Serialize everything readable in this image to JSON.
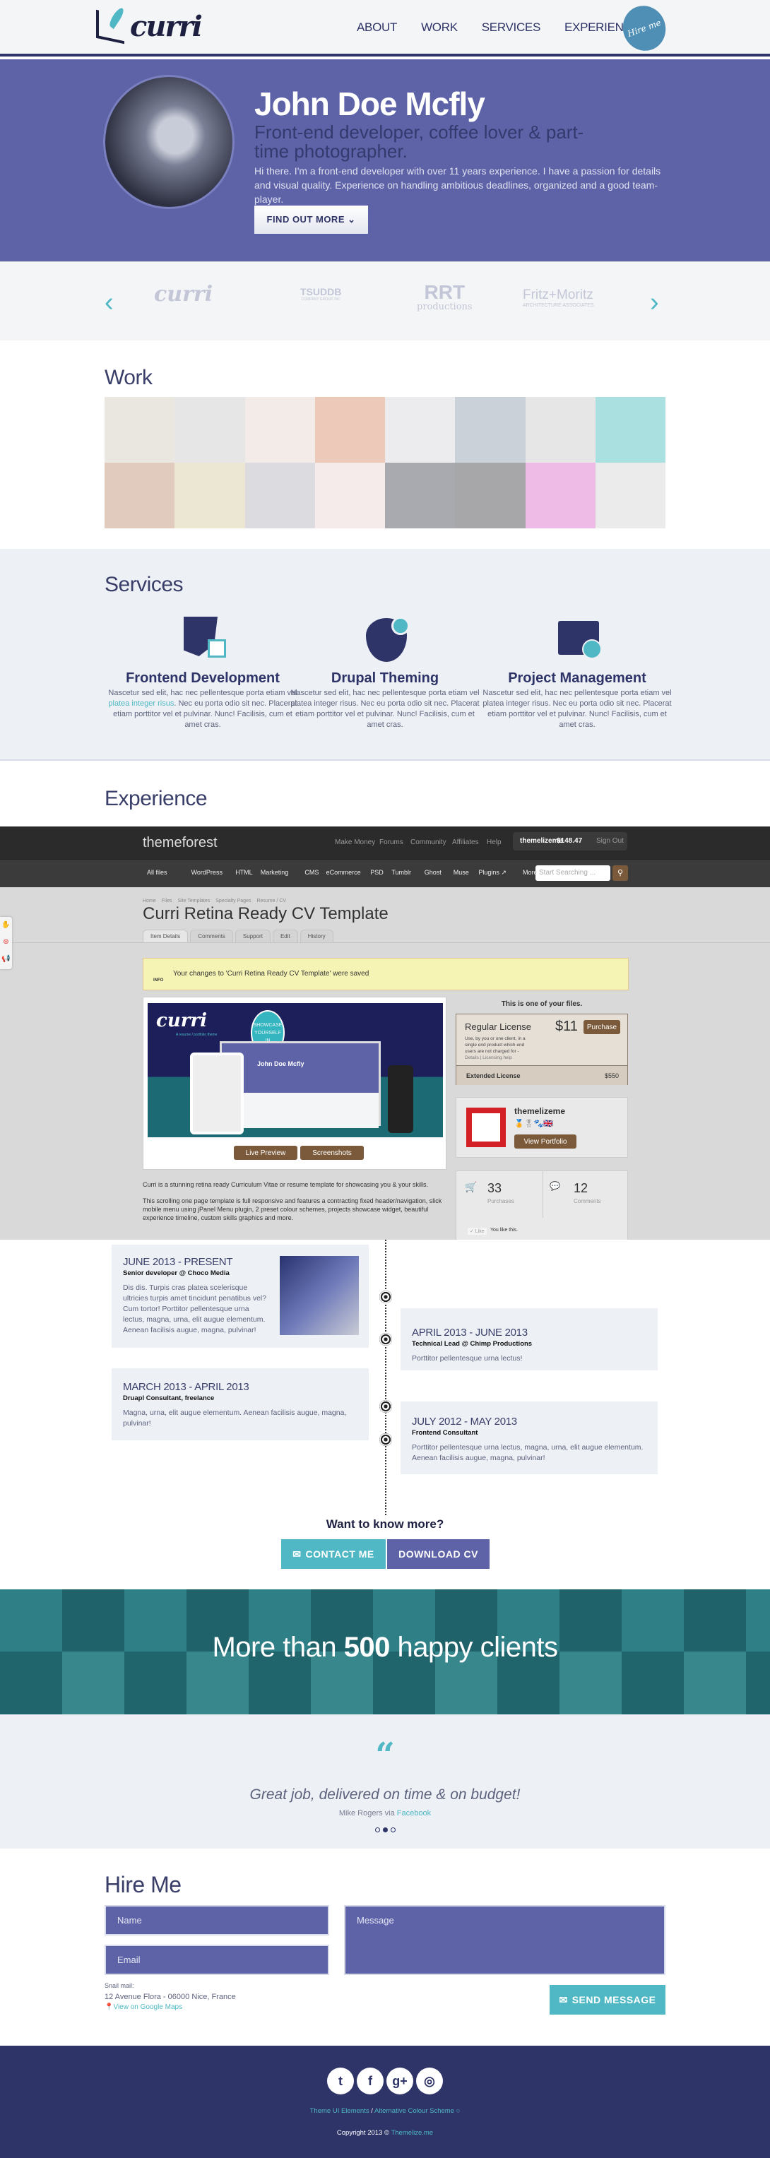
{
  "colors": {
    "primary": "#5e63a8",
    "dark": "#2e3468",
    "accent": "#4fb8c4",
    "light": "#edf0f5"
  },
  "header": {
    "logo": "curri",
    "nav": [
      "ABOUT",
      "WORK",
      "SERVICES",
      "EXPERIENCE"
    ],
    "hire_badge": "Hire me"
  },
  "hero": {
    "name": "John Doe Mcfly",
    "tagline": "Front-end developer, coffee lover & part-time photographer.",
    "intro": "Hi there. I'm a front-end developer with over 11 years experience. I have a passion for details and visual quality. Experience on handling ambitious deadlines, organized and a good team-player.",
    "button": "FIND OUT MORE ⌄"
  },
  "clients": {
    "logos": [
      {
        "name": "curri"
      },
      {
        "name": "TSUDDB",
        "sub": "COMPANY GROUP, INC"
      },
      {
        "name": "RRT",
        "sub": "productions"
      },
      {
        "name": "Fritz+Moritz",
        "sub": "ARCHITECTURE ASSOCIATES"
      }
    ]
  },
  "work": {
    "title": "Work"
  },
  "services": {
    "title": "Services",
    "items": [
      {
        "title": "Frontend Development",
        "icon": "css3-icon",
        "text_a": "Nascetur sed elit, hac nec pellentesque porta etiam vel ",
        "link": "platea integer risus",
        "text_b": ". Nec eu porta odio sit nec. Placerat etiam porttitor vel et pulvinar. Nunc! Facilisis, cum et amet cras."
      },
      {
        "title": "Drupal Theming",
        "icon": "drupal-icon",
        "text_a": "Nascetur sed elit, hac nec pellentesque porta etiam vel platea integer risus. Nec eu porta odio sit nec. Placerat etiam porttitor vel et pulvinar. Nunc! Facilisis, cum et amet cras.",
        "link": "",
        "text_b": ""
      },
      {
        "title": "Project Management",
        "icon": "folder-icon",
        "text_a": "Nascetur sed elit, hac nec pellentesque porta etiam vel platea integer risus. Nec eu porta odio sit nec. Placerat etiam porttitor vel et pulvinar. Nunc! Facilisis, cum et amet cras.",
        "link": "",
        "text_b": ""
      }
    ]
  },
  "experience": {
    "title": "Experience"
  },
  "themeforest": {
    "brand": "themeforest",
    "top_links": [
      "Make Money",
      "Forums",
      "Community",
      "Affiliates",
      "Help"
    ],
    "user": "themelizeme",
    "balance": "$148.47",
    "sign_out": "Sign Out",
    "categories": [
      "All files",
      "WordPress",
      "HTML",
      "Marketing",
      "CMS",
      "eCommerce",
      "PSD",
      "Tumblr",
      "Ghost",
      "Muse",
      "Plugins ↗",
      "More"
    ],
    "search_placeholder": "Start Searching ...",
    "breadcrumb": [
      "Home",
      "Files",
      "Site Templates",
      "Specialty Pages",
      "Resume / CV"
    ],
    "title": "Curri Retina Ready CV Template",
    "tabs": [
      "Item Details",
      "Comments",
      "Support",
      "Edit",
      "History"
    ],
    "notice_label": "INFO",
    "notice": "Your changes to 'Curri Retina Ready CV Template' were saved",
    "preview_bubble": "SHOWCASE YOURSELF IN STUNNING FASHION",
    "preview_name": "John Doe Mcfly",
    "preview_logo": "curri",
    "preview_logo_sub": "A resume / portfolio theme",
    "live_preview": "Live Preview",
    "screenshots": "Screenshots",
    "desc1": "Curri is a stunning retina ready Curriculum Vitae or resume template for showcasing you & your skills.",
    "desc2": "This scrolling one page template is full responsive and features a contracting fixed header/navigation, slick mobile menu using jPanel Menu plugin, 2 preset colour schemes, projects showcase widget, beautiful experience timeline, custom skills graphics and more.",
    "own_file": "This is one of your files.",
    "regular": "Regular License",
    "regular_price": "$11",
    "purchase": "Purchase",
    "regular_desc": "Use, by you or one client, in a single end product which end users are not charged for -",
    "details": "Details | Licensing help",
    "extended": "Extended License",
    "extended_price": "$550",
    "author": "themelizeme",
    "view_portfolio": "View Portfolio",
    "purchases": "33",
    "purchases_label": "Purchases",
    "comments": "12",
    "comments_label": "Comments",
    "like": "✓ Like",
    "you_like": "You like this."
  },
  "timeline": [
    {
      "date": "JUNE 2013 - PRESENT",
      "role": "Senior developer @ Choco Media",
      "text": "Dis dis. Turpis cras platea scelerisque ultricies turpis amet tincidunt penatibus vel? Cum tortor! Porttitor pellentesque urna lectus, magna, urna, elit augue elementum. Aenean facilisis augue, magna, pulvinar!"
    },
    {
      "date": "APRIL 2013 - JUNE 2013",
      "role": "Technical Lead @ Chimp Productions",
      "text": "Porttitor pellentesque urna lectus!"
    },
    {
      "date": "MARCH 2013 - APRIL 2013",
      "role": "Druapl Consultant, freelance",
      "text": "Magna, urna, elit augue elementum. Aenean facilisis augue, magna, pulvinar!"
    },
    {
      "date": "JULY 2012 - MAY 2013",
      "role": "Frontend Consultant",
      "text": "Porttitor pellentesque urna lectus, magna, urna, elit augue elementum. Aenean facilisis augue, magna, pulvinar!"
    }
  ],
  "cta": {
    "question": "Want to know more?",
    "contact": "CONTACT ME",
    "download": "DOWNLOAD CV"
  },
  "happy": {
    "pre": "More than ",
    "count": "500",
    "post": " happy clients"
  },
  "testimonial": {
    "quote": "Great job, delivered on time & on budget!",
    "author": "Mike Rogers via ",
    "source": "Facebook",
    "active_dot": 1
  },
  "hire": {
    "title": "Hire Me",
    "name_ph": "Name",
    "email_ph": "Email",
    "message_ph": "Message",
    "mail_label": "Snail mail:",
    "address": "12 Avenue Flora - 06000 Nice, France",
    "maps": "View on Google Maps",
    "send": "SEND MESSAGE"
  },
  "footer": {
    "social": [
      "twitter-icon",
      "facebook-icon",
      "google-plus-icon",
      "dribbble-icon"
    ],
    "link1": "Theme UI Elements",
    "sep": " / ",
    "link2": "Alternative Colour Scheme ○",
    "copyright": "Copyright 2013 © ",
    "copyright_link": "Themelize.me"
  }
}
